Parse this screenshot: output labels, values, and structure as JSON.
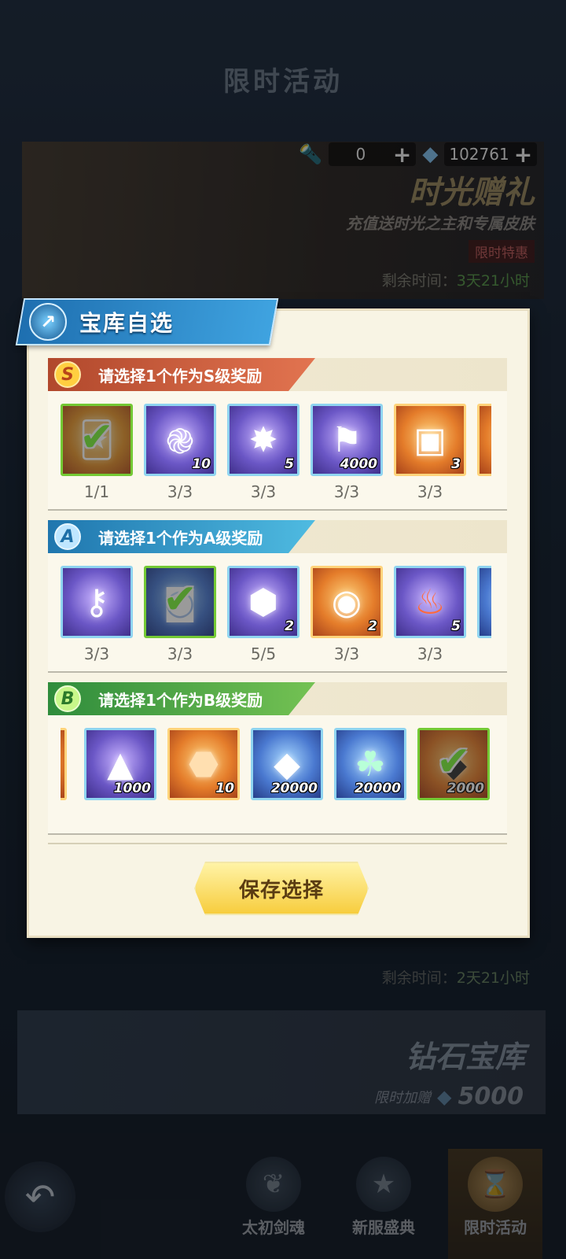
{
  "page": {
    "title": "限时活动"
  },
  "currency": {
    "tool_count": "0",
    "diamond_count": "102761"
  },
  "event_card": {
    "title": "时光赠礼",
    "subtitle": "充值送时光之主和专属皮肤",
    "badge": "限时特惠",
    "timer_label": "剩余时间：",
    "timer_value": "3天21小时"
  },
  "timer2": {
    "label": "剩余时间：",
    "value": "2天21小时"
  },
  "diamond_card": {
    "title": "钻石宝库",
    "label": "限时加赠",
    "amount": "5000"
  },
  "modal": {
    "title": "宝库自选",
    "save_label": "保存选择",
    "sections": [
      {
        "grade": "S",
        "label": "请选择1个作为S级奖励",
        "items": [
          {
            "icon": "card-icon",
            "qty": "",
            "count": "1/1",
            "selected": true
          },
          {
            "icon": "rune-icon",
            "qty": "10",
            "count": "3/3",
            "selected": false
          },
          {
            "icon": "star-emblem-icon",
            "qty": "5",
            "count": "3/3",
            "selected": false
          },
          {
            "icon": "banner-icon",
            "qty": "4000",
            "count": "3/3",
            "selected": false
          },
          {
            "icon": "chest-icon",
            "qty": "3",
            "count": "3/3",
            "selected": false
          }
        ]
      },
      {
        "grade": "A",
        "label": "请选择1个作为A级奖励",
        "items": [
          {
            "icon": "key-icon",
            "qty": "",
            "count": "3/3",
            "selected": false
          },
          {
            "icon": "bag-icon",
            "qty": "",
            "count": "3/3",
            "selected": true
          },
          {
            "icon": "crystal-icon",
            "qty": "2",
            "count": "5/5",
            "selected": false
          },
          {
            "icon": "orb-icon",
            "qty": "2",
            "count": "3/3",
            "selected": false
          },
          {
            "icon": "flame-icon",
            "qty": "5",
            "count": "3/3",
            "selected": false
          }
        ]
      },
      {
        "grade": "B",
        "label": "请选择1个作为B级奖励",
        "items": [
          {
            "icon": "shard-icon",
            "qty": "1000",
            "selected": false
          },
          {
            "icon": "gem-icon",
            "qty": "10",
            "selected": false
          },
          {
            "icon": "blue-crystal-icon",
            "qty": "20000",
            "selected": false
          },
          {
            "icon": "herb-icon",
            "qty": "20000",
            "selected": false
          },
          {
            "icon": "ore-icon",
            "qty": "2000",
            "selected": true
          }
        ]
      }
    ]
  },
  "nav": {
    "tabs": [
      {
        "label": "太初剑魂",
        "icon": "laurel-icon"
      },
      {
        "label": "新服盛典",
        "icon": "star-icon"
      },
      {
        "label": "限时活动",
        "icon": "hourglass-icon"
      }
    ]
  }
}
